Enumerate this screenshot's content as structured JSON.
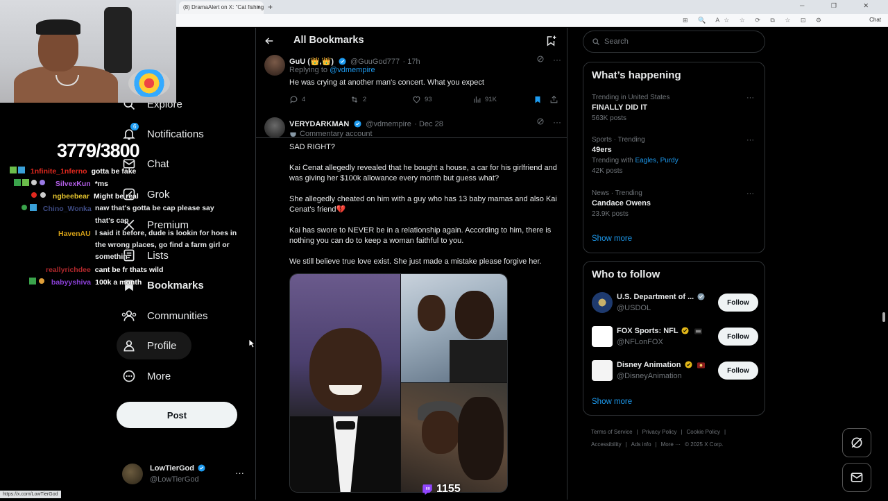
{
  "browser": {
    "tab_title": "(8) DramaAlert on X: \"Cat fishing i",
    "tab_close": "×",
    "new_tab": "+",
    "window_controls": "─ ❐ ✕",
    "toolbar_icons": "⊞ 🔍 A☆ ☆ ⟳ ⧉ ☆ ⊡ ⚙",
    "chat_label": "Chat",
    "status_url": "https://x.com/LowTierGod"
  },
  "stream": {
    "sub_goal": "3779/3800",
    "chat": [
      {
        "user": "1nfinite_1nferno",
        "color": "#e0281e",
        "badges": "",
        "msg": "gotta be fake"
      },
      {
        "user": "SilvexKun",
        "color": "#b25ee6",
        "badges": "",
        "msg": "*ms"
      },
      {
        "user": "ngbeebear",
        "color": "#e2c22d",
        "badges": "",
        "msg": "Might be real"
      },
      {
        "user": "Chino_Wonka",
        "color": "#3d4a82",
        "badges": "",
        "msg": "naw that's gotta be cap please say that's cap"
      },
      {
        "user": "HavenAU",
        "color": "#d4a017",
        "badges": "",
        "msg": "I said it before, dude is lookin for hoes in the wrong places, go find a farm girl or somethin"
      },
      {
        "user": "reallyrichdee",
        "color": "#b0282c",
        "badges": "",
        "msg": "cant be fr thats wild"
      },
      {
        "user": "babyyshiva",
        "color": "#8a3fd6",
        "badges": "",
        "msg": "100k a month"
      }
    ],
    "viewers": "1155"
  },
  "nav": {
    "items": [
      {
        "label": "Explore",
        "icon": "search-icon"
      },
      {
        "label": "Notifications",
        "icon": "bell-icon",
        "badge": "6"
      },
      {
        "label": "Chat",
        "icon": "mail-icon"
      },
      {
        "label": "Grok",
        "icon": "grok-icon"
      },
      {
        "label": "Premium",
        "icon": "x-logo-icon"
      },
      {
        "label": "Lists",
        "icon": "list-icon"
      },
      {
        "label": "Bookmarks",
        "icon": "bookmark-icon"
      },
      {
        "label": "Communities",
        "icon": "communities-icon"
      },
      {
        "label": "Profile",
        "icon": "person-icon"
      },
      {
        "label": "More",
        "icon": "more-circle-icon"
      }
    ],
    "post_button": "Post",
    "account": {
      "name": "LowTierGod",
      "handle": "@LowTierGod",
      "more": "···"
    }
  },
  "center": {
    "title": "All Bookmarks",
    "tweet1": {
      "name": "GuU (👑,👑)",
      "handle": "@GuuGod777",
      "time": "· 17h",
      "replying_prefix": "Replying to ",
      "replying_to": "@vdmempire",
      "text": "He was crying at another man's concert. What you expect",
      "replies": "4",
      "retweets": "2",
      "likes": "93",
      "views": "91K"
    },
    "tweet2": {
      "name": "VERYDARKMAN",
      "handle": "@vdmempire",
      "time": "· Dec 28",
      "label": "Commentary account",
      "p1": "SAD RIGHT?",
      "p2": "Kai Cenat allegedly revealed that he bought a house, a car for his girlfriend and was giving her $100k allowance every month but guess what?",
      "p3": "She allegedly cheated on him with a guy who has 13 baby mamas and also Kai Cenat's friend💔",
      "p4": "Kai has swore to NEVER be in a relationship again. According to him, there is nothing you can do to keep a woman faithful to you.",
      "p5": "We still believe true love exist. She just made a mistake please forgive her."
    },
    "more_dots": "···"
  },
  "right": {
    "search_placeholder": "Search",
    "happening_title": "What’s happening",
    "trends": [
      {
        "context": "Trending in United States",
        "name": "FINALLY DID IT",
        "count": "563K posts"
      },
      {
        "context": "Sports · Trending",
        "name": "49ers",
        "count_prefix": "Trending with ",
        "count_links": "Eagles, Purdy",
        "count": "42K posts"
      },
      {
        "context": "News · Trending",
        "name": "Candace Owens",
        "count": "23.9K posts"
      }
    ],
    "show_more": "Show more",
    "wtf_title": "Who to follow",
    "follow_suggestions": [
      {
        "name": "U.S. Department of ...",
        "handle": "@USDOL",
        "button": "Follow"
      },
      {
        "name": "FOX Sports: NFL",
        "handle": "@NFLonFOX",
        "button": "Follow"
      },
      {
        "name": "Disney Animation",
        "handle": "@DisneyAnimation",
        "button": "Follow"
      }
    ],
    "footer": [
      "Terms of Service",
      "|",
      "Privacy Policy",
      "|",
      "Cookie Policy",
      "|",
      "Accessibility",
      "|",
      "Ads info",
      "|",
      "More ···",
      "© 2025 X Corp."
    ]
  },
  "colors": {
    "accent": "#1d9bf0",
    "bg": "#000000",
    "border": "#2f3336",
    "muted": "#71767b"
  }
}
